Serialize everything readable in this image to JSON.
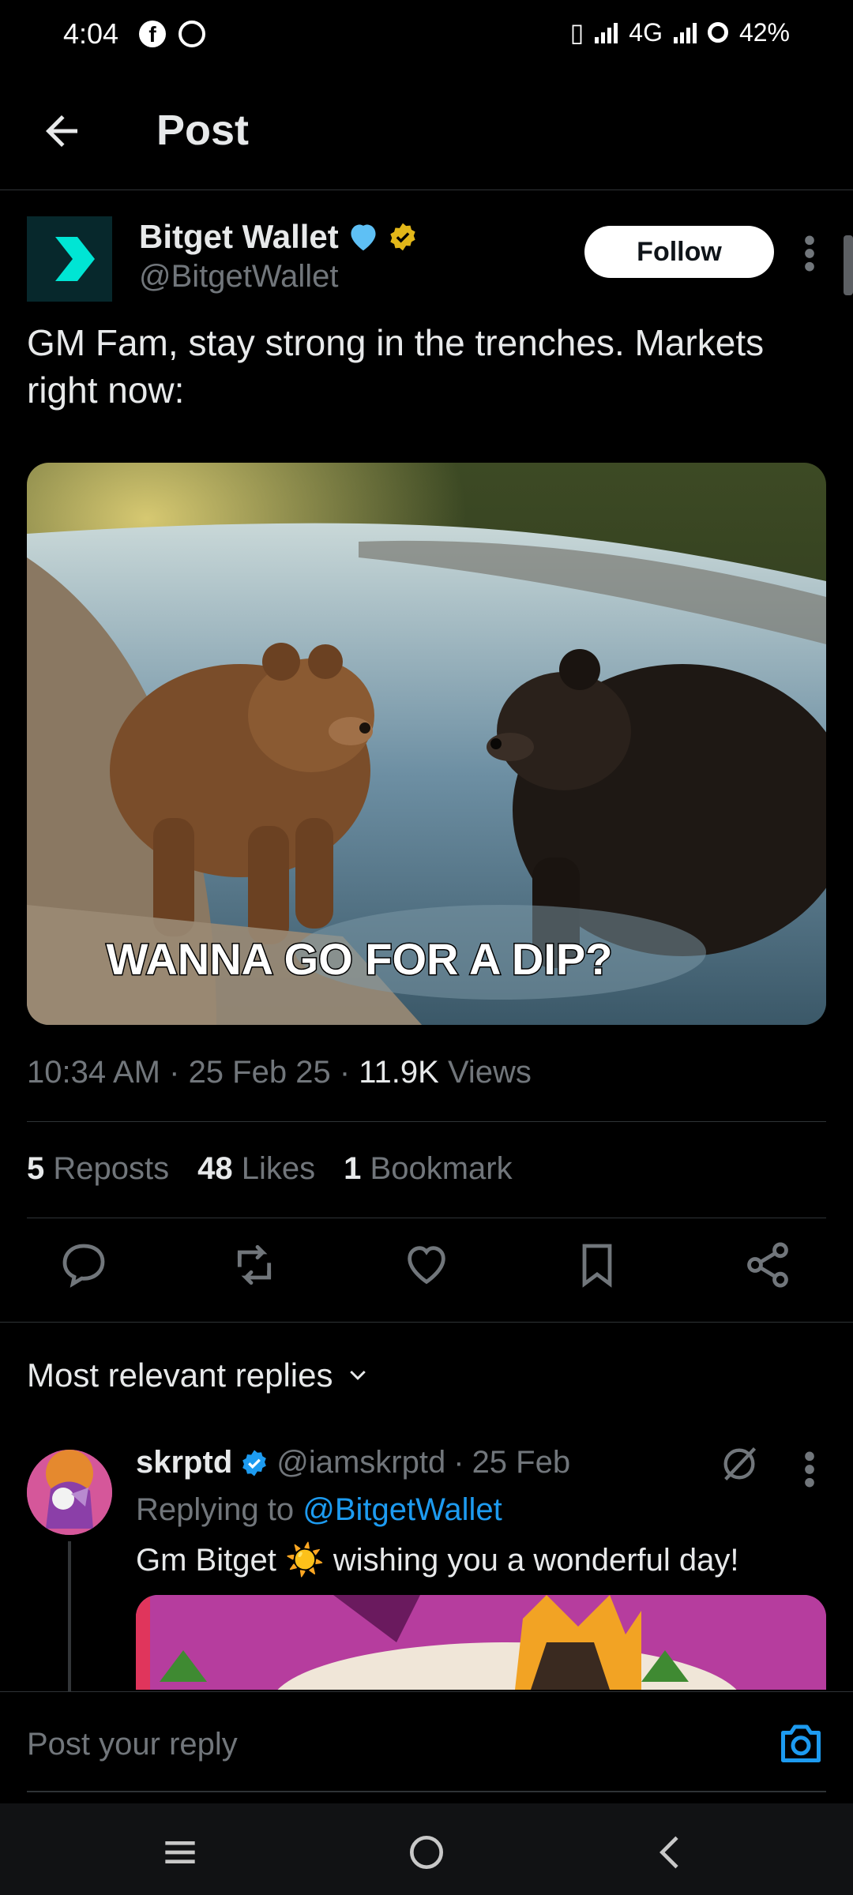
{
  "status_bar": {
    "time": "4:04",
    "network": "4G",
    "battery": "42%"
  },
  "header": {
    "title": "Post"
  },
  "post": {
    "author_name": "Bitget Wallet",
    "author_handle": "@BitgetWallet",
    "follow_label": "Follow",
    "text": "GM Fam, stay strong in the trenches. Markets right now:",
    "image_caption": "WANNA GO FOR A DIP?",
    "time": "10:34 AM",
    "date": "25 Feb 25",
    "views_count": "11.9K",
    "views_label": "Views",
    "reposts_count": "5",
    "reposts_label": "Reposts",
    "likes_count": "48",
    "likes_label": "Likes",
    "bookmarks_count": "1",
    "bookmarks_label": "Bookmark"
  },
  "replies": {
    "sort_label": "Most relevant replies",
    "items": [
      {
        "name": "skrptd",
        "handle": "@iamskrptd",
        "date": "25 Feb",
        "replying_prefix": "Replying to",
        "replying_to": "@BitgetWallet",
        "text": "Gm Bitget ☀️ wishing you a wonderful day!"
      }
    ]
  },
  "composer": {
    "placeholder": "Post your reply"
  },
  "colors": {
    "background": "#000000",
    "text": "#e7e9ea",
    "muted": "#71767b",
    "accent": "#1d9bf0",
    "divider": "#2f3336"
  },
  "icons": [
    "back-arrow-icon",
    "more-vertical-icon",
    "reply-icon",
    "repost-icon",
    "like-icon",
    "bookmark-icon",
    "share-icon",
    "chevron-down-icon",
    "verified-badge-icon",
    "grok-icon",
    "camera-icon",
    "menu-icon",
    "home-circle-icon",
    "back-chevron-icon"
  ]
}
